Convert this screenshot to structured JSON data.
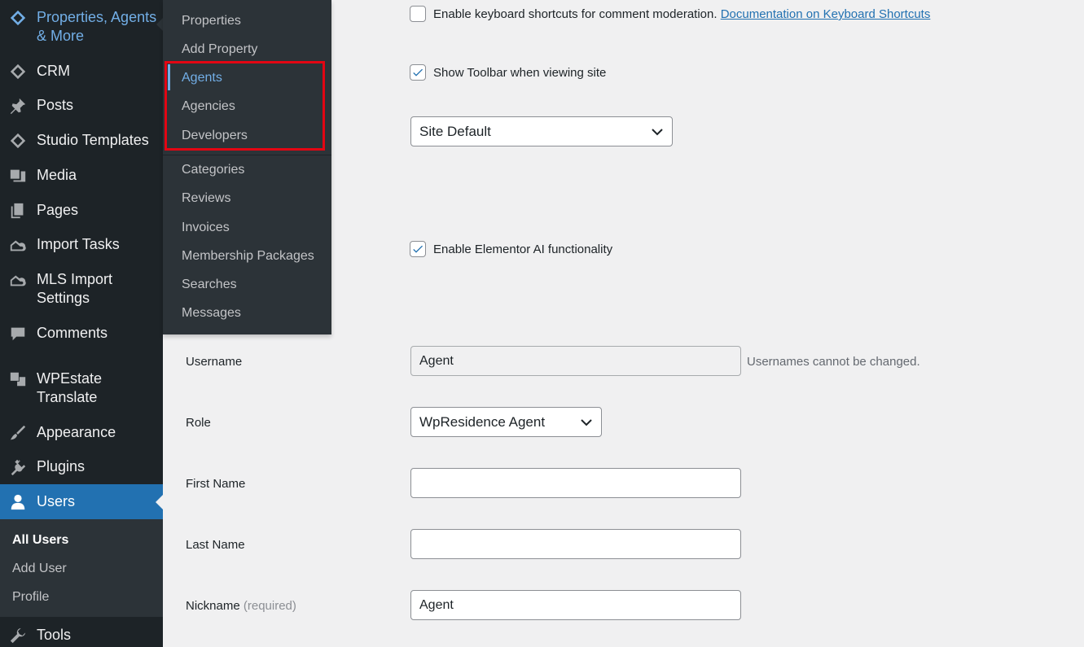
{
  "sidebar": {
    "items": [
      {
        "label": "Properties, Agents & More",
        "icon": "diamond-icon"
      },
      {
        "label": "CRM",
        "icon": "diamond-icon"
      },
      {
        "label": "Posts",
        "icon": "pushpin-icon"
      },
      {
        "label": "Studio Templates",
        "icon": "diamond-icon"
      },
      {
        "label": "Media",
        "icon": "media-icon"
      },
      {
        "label": "Pages",
        "icon": "pages-icon"
      },
      {
        "label": "Import Tasks",
        "icon": "cloud-house-icon"
      },
      {
        "label": "MLS Import Settings",
        "icon": "cloud-house-icon"
      },
      {
        "label": "Comments",
        "icon": "comment-icon"
      },
      {
        "label": "WPEstate Translate",
        "icon": "translate-icon"
      },
      {
        "label": "Appearance",
        "icon": "paintbrush-icon"
      },
      {
        "label": "Plugins",
        "icon": "plugin-icon"
      },
      {
        "label": "Users",
        "icon": "user-icon"
      },
      {
        "label": "Tools",
        "icon": "wrench-icon"
      }
    ],
    "users_submenu": [
      "All Users",
      "Add User",
      "Profile"
    ]
  },
  "flyout": {
    "items": [
      "Properties",
      "Add Property",
      "Agents",
      "Agencies",
      "Developers",
      "Categories",
      "Reviews",
      "Invoices",
      "Membership Packages",
      "Searches",
      "Messages"
    ],
    "current": "Agents"
  },
  "form": {
    "keyboard_shortcuts_label": "Enable keyboard shortcuts for comment moderation.",
    "keyboard_shortcuts_link": "Documentation on Keyboard Shortcuts",
    "keyboard_shortcuts_checked": false,
    "toolbar_label": "Show Toolbar when viewing site",
    "toolbar_checked": true,
    "language_select": "Site Default",
    "elementor_ai_label": "Enable Elementor AI functionality",
    "elementor_ai_checked": true,
    "username_label": "Username",
    "username_value": "Agent",
    "username_hint": "Usernames cannot be changed.",
    "role_label": "Role",
    "role_value": "WpResidence Agent",
    "first_name_label": "First Name",
    "first_name_value": "",
    "last_name_label": "Last Name",
    "last_name_value": "",
    "nickname_label": "Nickname",
    "nickname_required": "(required)",
    "nickname_value": "Agent"
  },
  "colors": {
    "sidebar_bg": "#1d2327",
    "submenu_bg": "#2c3338",
    "accent": "#2271b1",
    "link_blue": "#72aee6",
    "highlight_red": "#e30613"
  }
}
